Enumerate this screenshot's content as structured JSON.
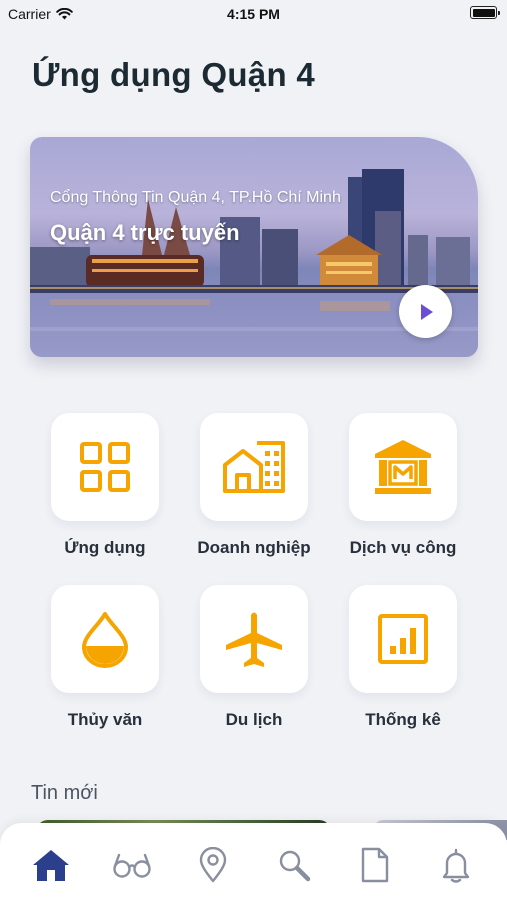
{
  "status_bar": {
    "carrier": "Carrier",
    "time": "4:15 PM"
  },
  "page_title": "Ứng dụng Quận 4",
  "banner": {
    "subtitle": "Cổng Thông Tin Quận 4, TP.Hồ Chí Minh",
    "title": "Quận 4 trực tuyến"
  },
  "services": [
    {
      "label": "Ứng dụng",
      "icon": "grid-apps-icon"
    },
    {
      "label": "Doanh nghiệp",
      "icon": "business-buildings-icon"
    },
    {
      "label": "Dịch vụ công",
      "icon": "public-service-building-icon"
    },
    {
      "label": "Thủy văn",
      "icon": "water-drop-icon"
    },
    {
      "label": "Du lịch",
      "icon": "airplane-icon"
    },
    {
      "label": "Thống kê",
      "icon": "statistics-chart-icon"
    }
  ],
  "news": {
    "heading": "Tin mới"
  },
  "tabs": [
    {
      "name": "home",
      "icon": "home-icon",
      "active": true
    },
    {
      "name": "glasses",
      "icon": "glasses-icon",
      "active": false
    },
    {
      "name": "map",
      "icon": "map-pin-icon",
      "active": false
    },
    {
      "name": "search",
      "icon": "search-icon",
      "active": false
    },
    {
      "name": "document",
      "icon": "document-icon",
      "active": false
    },
    {
      "name": "notifications",
      "icon": "bell-icon",
      "active": false
    }
  ],
  "colors": {
    "accent": "#f5a400",
    "tab_active": "#2c3f8c",
    "tab_inactive": "#8a8fa0",
    "background": "#f1f2f6"
  }
}
